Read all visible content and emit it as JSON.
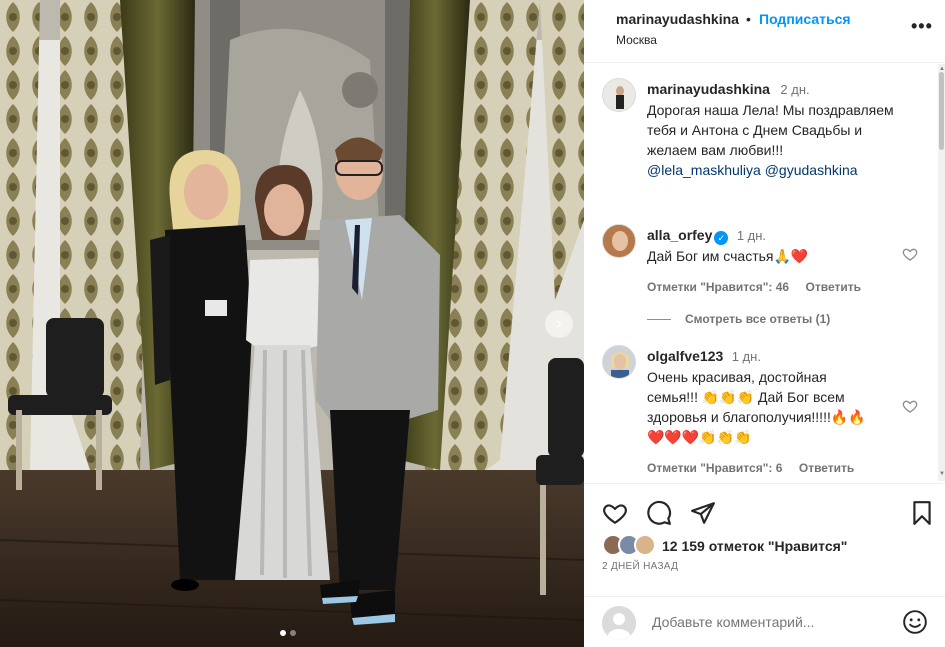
{
  "post": {
    "author": "marinayudashkina",
    "follow_label": "Подписаться",
    "separator": "•",
    "location": "Москва",
    "more_label": "•••"
  },
  "caption": {
    "username": "marinayudashkina",
    "time": "2 дн.",
    "lines": [
      "Дорогая наша Лела! Мы поздравляем",
      "тебя и Антона с Днем Свадьбы и",
      "желаем вам любви!!!"
    ],
    "mentions": [
      "@lela_maskhuliya",
      "@gyudashkina"
    ]
  },
  "comments": [
    {
      "username": "alla_orfey",
      "verified": true,
      "time": "1 дн.",
      "text": "Дай Бог им счастья🙏❤️",
      "likes_label": "Отметки \"Нравится\": 46",
      "reply_label": "Ответить",
      "view_replies": "Смотреть все ответы (1)"
    },
    {
      "username": "olgalfve123",
      "verified": false,
      "time": "1 дн.",
      "lines": [
        "Очень красивая, достойная",
        "семья!!! 👏👏👏 Дай Бог всем",
        "здоровья и благополучия!!!!!🔥🔥",
        "❤️❤️❤️👏👏👏"
      ],
      "likes_label": "Отметки \"Нравится\": 6",
      "reply_label": "Ответить"
    }
  ],
  "actions": {
    "likes_count": "12 159 отметок \"Нравится\"",
    "date": "2 ДНЕЙ НАЗАД",
    "comment_placeholder": "Добавьте комментарий..."
  },
  "carousel": {
    "total": 2,
    "current": 1
  },
  "icons": [
    "heart-icon",
    "comment-icon",
    "share-icon",
    "bookmark-icon",
    "emoji-icon",
    "chevron-right-icon",
    "verified-icon",
    "more-icon"
  ],
  "colors": {
    "accent": "#0095f6",
    "text": "#262626",
    "muted": "#737373",
    "heart_red": "#ed4956"
  }
}
